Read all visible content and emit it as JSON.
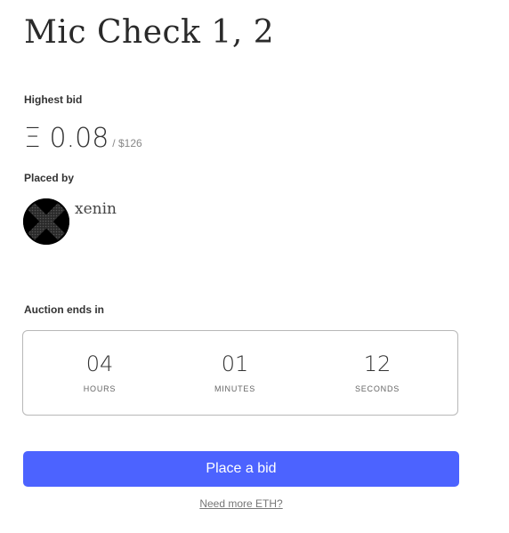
{
  "title": "Mic Check 1, 2",
  "bid": {
    "label": "Highest bid",
    "amount": "Ξ 0.08",
    "usd": "/ $126"
  },
  "placed_by": {
    "label": "Placed by",
    "name": "xenin",
    "avatar_icon": "x-avatar-icon"
  },
  "auction": {
    "label": "Auction ends in",
    "hours_value": "04",
    "hours_label": "HOURS",
    "minutes_value": "01",
    "minutes_label": "MINUTES",
    "seconds_value": "12",
    "seconds_label": "SECONDS"
  },
  "actions": {
    "place_bid_label": "Place a bid",
    "need_eth_label": "Need more ETH?"
  },
  "colors": {
    "accent": "#4c63ff",
    "avatar_bg": "#000000"
  }
}
